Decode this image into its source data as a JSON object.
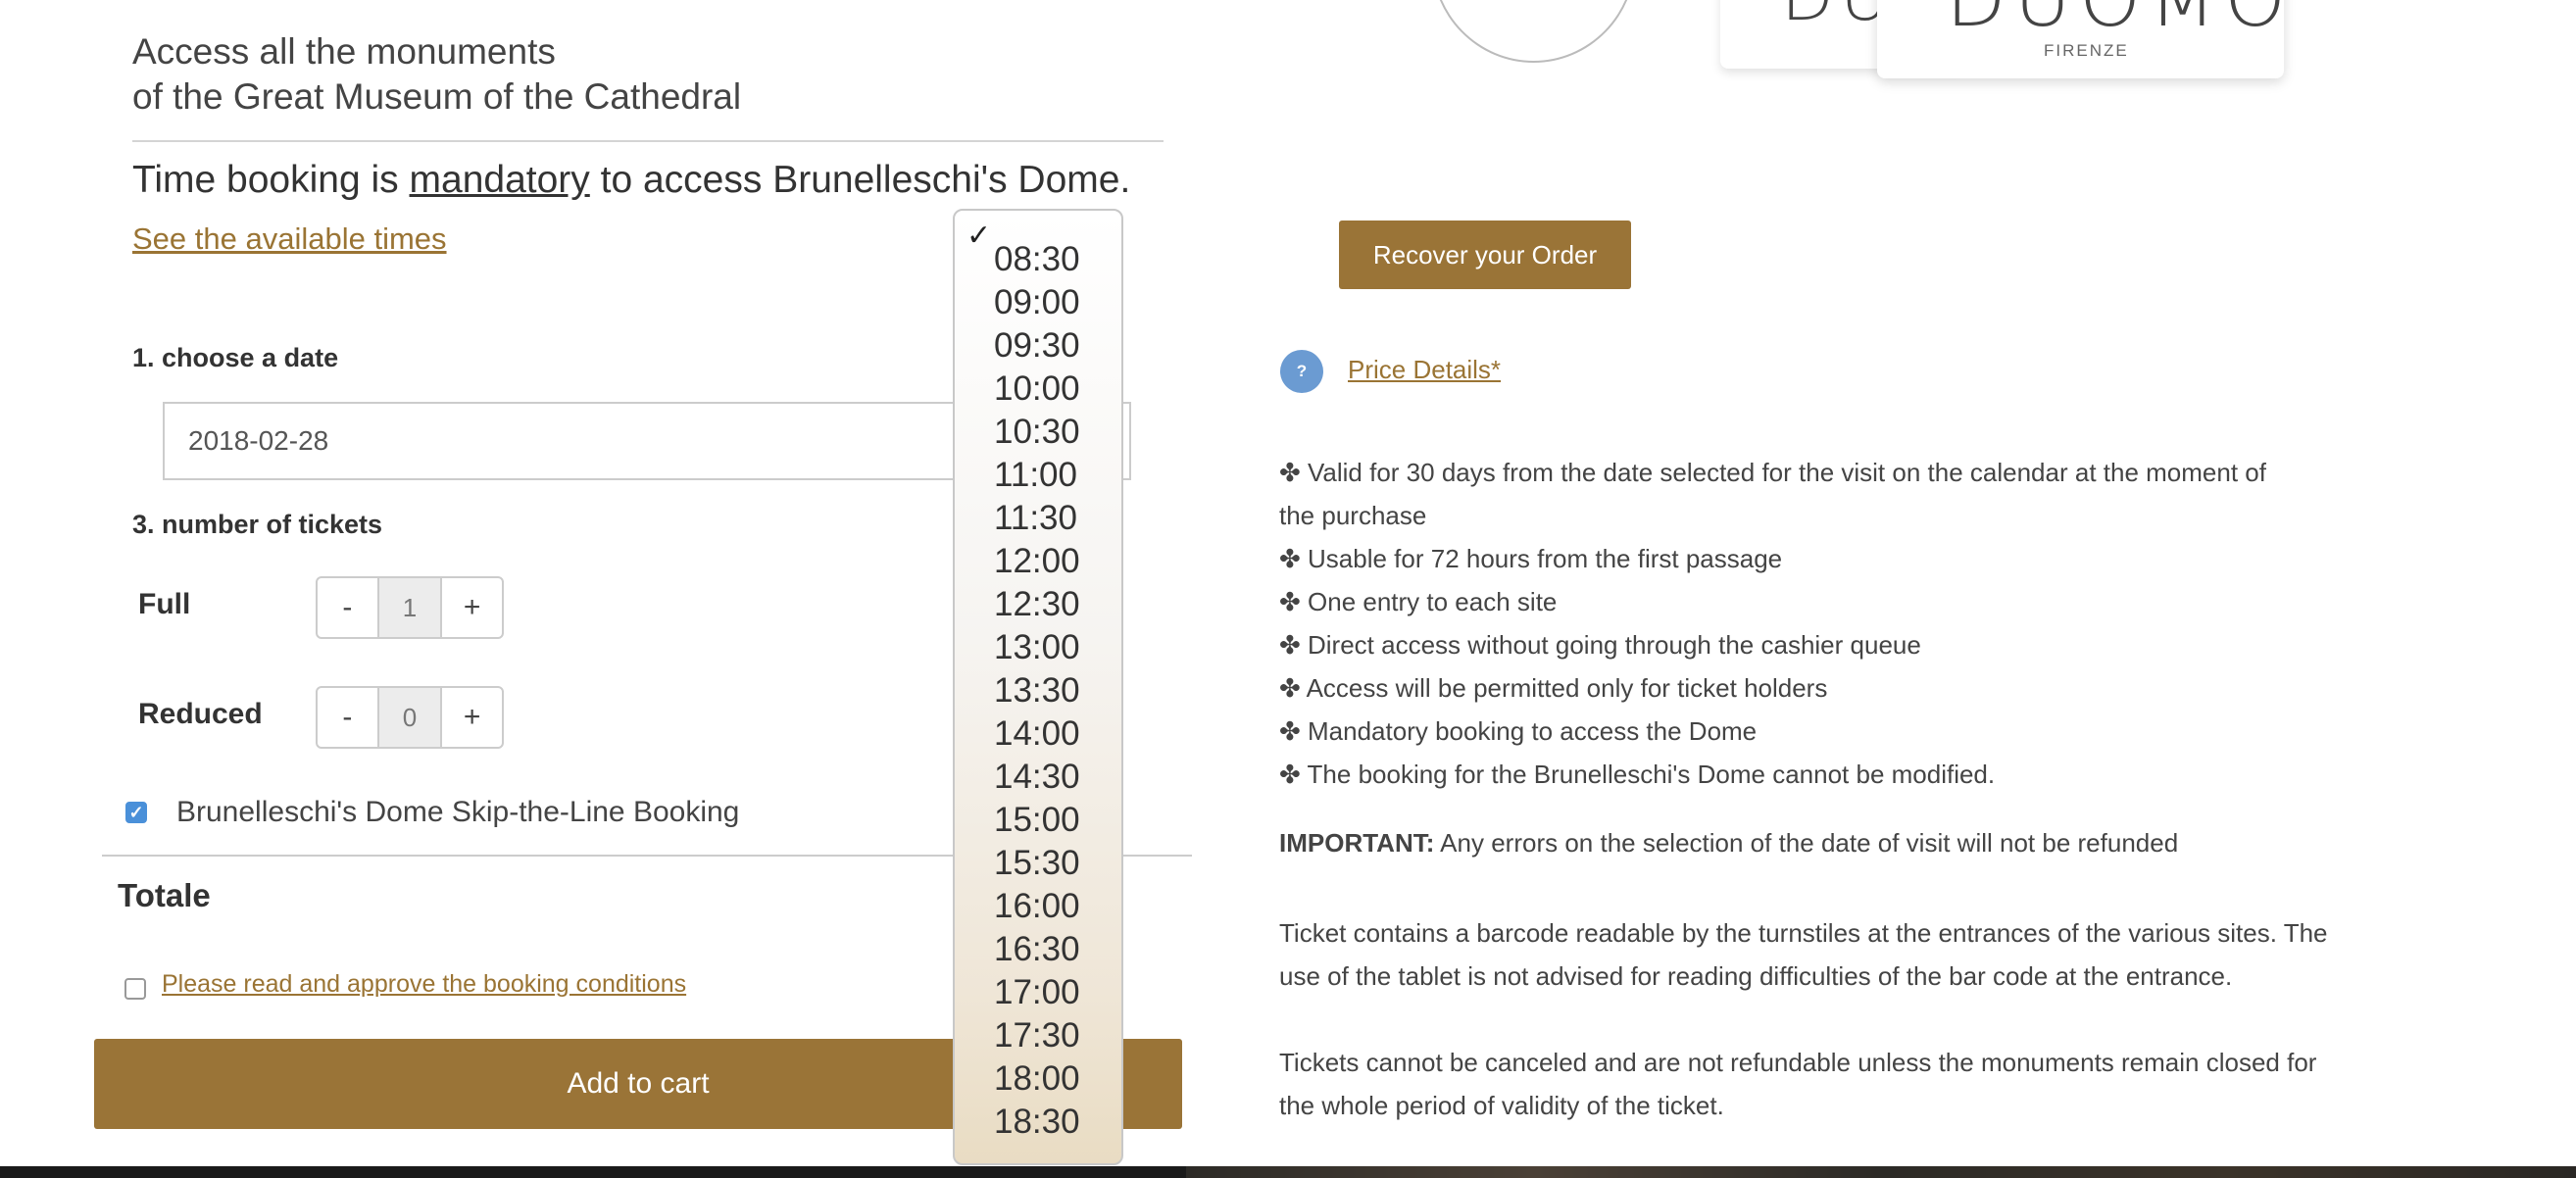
{
  "intro": {
    "line1": "Access all the monuments",
    "line2": "of the Great Museum of the Cathedral"
  },
  "booking_notice": {
    "before": "Time booking is ",
    "emphasis": "mandatory",
    "after": " to access Brunelleschi's Dome."
  },
  "see_times_link": "See the available times",
  "step1_label": "1. choose a date",
  "date_value": "2018-02-28",
  "step3_label": "3. number of tickets",
  "tickets": [
    {
      "label": "Full",
      "minus": "-",
      "value": "1",
      "plus": "+"
    },
    {
      "label": "Reduced",
      "minus": "-",
      "value": "0",
      "plus": "+"
    }
  ],
  "dome_option": {
    "label": "Brunelleschi's Dome Skip-the-Line Booking",
    "checked": true
  },
  "totale_label": "Totale",
  "conditions_link": "Please read and approve the booking conditions",
  "add_to_cart": "Add to cart",
  "time_dropdown": {
    "checkmark": "✓",
    "options": [
      "08:30",
      "09:00",
      "09:30",
      "10:00",
      "10:30",
      "11:00",
      "11:30",
      "12:00",
      "12:30",
      "13:00",
      "13:30",
      "14:00",
      "14:30",
      "15:00",
      "15:30",
      "16:00",
      "16:30",
      "17:00",
      "17:30",
      "18:00",
      "18:30"
    ]
  },
  "logo": {
    "word_a": "DU",
    "word_b": "DUOMO",
    "sub": "FIRENZE"
  },
  "recover_button": "Recover your Order",
  "price_icon": "?",
  "price_details_link": "Price Details*",
  "features": [
    "✤ Valid for 30 days from the date selected for the visit on the calendar at the moment of the purchase",
    "✤ Usable for 72 hours from the first passage",
    "✤ One entry to each site",
    "✤ Direct access without going through the cashier queue",
    "✤ Access will be permitted only for ticket holders",
    "✤ Mandatory booking to access the Dome",
    "✤ The booking for the Brunelleschi's Dome cannot be modified."
  ],
  "important": {
    "label": "IMPORTANT:",
    "text": " Any errors on the selection of the date of visit will not be refunded"
  },
  "paragraph_barcode": "Ticket contains a barcode readable by the turnstiles at the entrances of the various sites. The use of the tablet is not advised for reading difficulties of the bar code at the entrance.",
  "paragraph_refund": "Tickets cannot be canceled and are not refundable unless the monuments remain closed for the whole period of validity of the ticket.",
  "colors": {
    "accent": "#9a7437",
    "link": "#9a7434",
    "checkbox": "#4a90d9",
    "help_icon": "#6b9bd2"
  }
}
